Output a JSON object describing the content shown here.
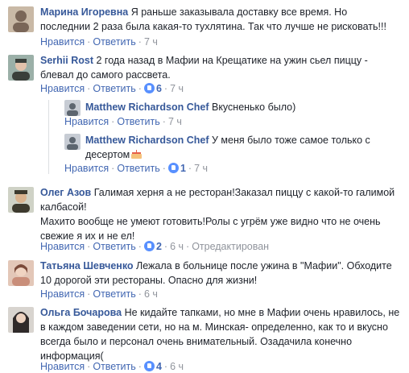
{
  "comments": [
    {
      "author": "Марина Игоревна",
      "lines": [
        "Я раньше заказывала доставку все время. Но",
        "последнии 2 раза была какая-то тухлятина. Так что лучше не рисковать!!!"
      ],
      "like": "Нравится",
      "reply": "Ответить",
      "likes": "",
      "time": "7 ч",
      "avatar_colors": [
        "#c9b9a6",
        "#7a6658"
      ]
    },
    {
      "author": "Serhii Rost",
      "lines": [
        "2 года назад в Мафии на Крещатике на ужин сьел пиццу -",
        "блевал до самого рассвета."
      ],
      "like": "Нравится",
      "reply": "Ответить",
      "likes": "6",
      "time": "7 ч",
      "avatar_colors": [
        "#9bb0a8",
        "#3a3f3a"
      ]
    },
    {
      "author": "Matthew Richardson Chef",
      "lines": [
        "Вкусненько было)"
      ],
      "like": "Нравится",
      "reply": "Ответить",
      "likes": "",
      "time": "7 ч",
      "avatar_colors": [
        "#c7ccd4",
        "#5d6670"
      ]
    },
    {
      "author": "Matthew Richardson Chef",
      "lines": [
        "У меня было тоже самое только с",
        "десертом"
      ],
      "like": "Нравится",
      "reply": "Ответить",
      "likes": "1",
      "time": "7 ч",
      "avatar_colors": [
        "#c7ccd4",
        "#5d6670"
      ]
    },
    {
      "author": "Олег Азов",
      "lines": [
        "Галимая херня а не ресторан!Заказал пиццу с какой-то галимой",
        "калбасой!",
        "Махито вообще не умеют готовить!Ролы с угрём уже видно что не очень",
        "свежие я их и не ел!"
      ],
      "like": "Нравится",
      "reply": "Ответить",
      "likes": "2",
      "time": "6 ч",
      "edited": "Отредактирован",
      "avatar_colors": [
        "#cfd2c6",
        "#3d3a2e"
      ]
    },
    {
      "author": "Татьяна Шевченко",
      "lines": [
        "Лежала в больнице после ужина в \"Мафии\". Обходите",
        "10 дорогой эти рестораны. Опасно для жизни!"
      ],
      "like": "Нравится",
      "reply": "Ответить",
      "likes": "",
      "time": "6 ч",
      "avatar_colors": [
        "#e3c7b8",
        "#7b4a3a"
      ]
    },
    {
      "author": "Ольга Бочарова",
      "lines": [
        "Не кидайте тапками, но мне в Мафии очень нравилось, не",
        "в каждом заведении сети, но на м. Минская- определенно, как то и вкусно",
        "всегда было и персонал очень внимательный. Озадачила конечно",
        "информация("
      ],
      "like": "Нравится",
      "reply": "Ответить",
      "likes": "4",
      "time": "6 ч",
      "avatar_colors": [
        "#d8d4cf",
        "#2f2a2a"
      ]
    }
  ],
  "colors": {
    "link": "#4267b2",
    "author": "#365899",
    "meta": "#90949c",
    "like_badge": "#5890ff"
  },
  "icons": {
    "like": "thumbs-up-icon",
    "dessert": "cake-emoji"
  }
}
